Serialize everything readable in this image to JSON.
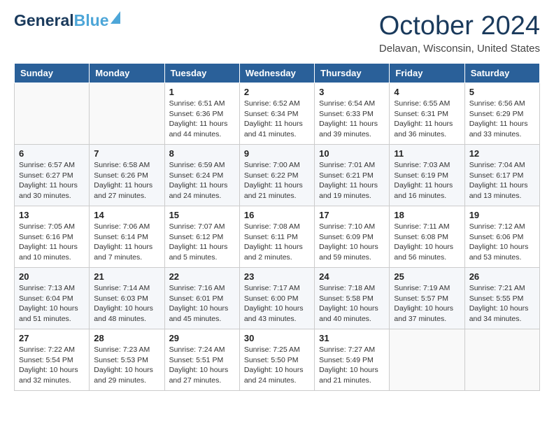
{
  "header": {
    "logo_general": "General",
    "logo_blue": "Blue",
    "month_title": "October 2024",
    "location": "Delavan, Wisconsin, United States"
  },
  "weekdays": [
    "Sunday",
    "Monday",
    "Tuesday",
    "Wednesday",
    "Thursday",
    "Friday",
    "Saturday"
  ],
  "weeks": [
    [
      {
        "day": "",
        "info": ""
      },
      {
        "day": "",
        "info": ""
      },
      {
        "day": "1",
        "info": "Sunrise: 6:51 AM\nSunset: 6:36 PM\nDaylight: 11 hours and 44 minutes."
      },
      {
        "day": "2",
        "info": "Sunrise: 6:52 AM\nSunset: 6:34 PM\nDaylight: 11 hours and 41 minutes."
      },
      {
        "day": "3",
        "info": "Sunrise: 6:54 AM\nSunset: 6:33 PM\nDaylight: 11 hours and 39 minutes."
      },
      {
        "day": "4",
        "info": "Sunrise: 6:55 AM\nSunset: 6:31 PM\nDaylight: 11 hours and 36 minutes."
      },
      {
        "day": "5",
        "info": "Sunrise: 6:56 AM\nSunset: 6:29 PM\nDaylight: 11 hours and 33 minutes."
      }
    ],
    [
      {
        "day": "6",
        "info": "Sunrise: 6:57 AM\nSunset: 6:27 PM\nDaylight: 11 hours and 30 minutes."
      },
      {
        "day": "7",
        "info": "Sunrise: 6:58 AM\nSunset: 6:26 PM\nDaylight: 11 hours and 27 minutes."
      },
      {
        "day": "8",
        "info": "Sunrise: 6:59 AM\nSunset: 6:24 PM\nDaylight: 11 hours and 24 minutes."
      },
      {
        "day": "9",
        "info": "Sunrise: 7:00 AM\nSunset: 6:22 PM\nDaylight: 11 hours and 21 minutes."
      },
      {
        "day": "10",
        "info": "Sunrise: 7:01 AM\nSunset: 6:21 PM\nDaylight: 11 hours and 19 minutes."
      },
      {
        "day": "11",
        "info": "Sunrise: 7:03 AM\nSunset: 6:19 PM\nDaylight: 11 hours and 16 minutes."
      },
      {
        "day": "12",
        "info": "Sunrise: 7:04 AM\nSunset: 6:17 PM\nDaylight: 11 hours and 13 minutes."
      }
    ],
    [
      {
        "day": "13",
        "info": "Sunrise: 7:05 AM\nSunset: 6:16 PM\nDaylight: 11 hours and 10 minutes."
      },
      {
        "day": "14",
        "info": "Sunrise: 7:06 AM\nSunset: 6:14 PM\nDaylight: 11 hours and 7 minutes."
      },
      {
        "day": "15",
        "info": "Sunrise: 7:07 AM\nSunset: 6:12 PM\nDaylight: 11 hours and 5 minutes."
      },
      {
        "day": "16",
        "info": "Sunrise: 7:08 AM\nSunset: 6:11 PM\nDaylight: 11 hours and 2 minutes."
      },
      {
        "day": "17",
        "info": "Sunrise: 7:10 AM\nSunset: 6:09 PM\nDaylight: 10 hours and 59 minutes."
      },
      {
        "day": "18",
        "info": "Sunrise: 7:11 AM\nSunset: 6:08 PM\nDaylight: 10 hours and 56 minutes."
      },
      {
        "day": "19",
        "info": "Sunrise: 7:12 AM\nSunset: 6:06 PM\nDaylight: 10 hours and 53 minutes."
      }
    ],
    [
      {
        "day": "20",
        "info": "Sunrise: 7:13 AM\nSunset: 6:04 PM\nDaylight: 10 hours and 51 minutes."
      },
      {
        "day": "21",
        "info": "Sunrise: 7:14 AM\nSunset: 6:03 PM\nDaylight: 10 hours and 48 minutes."
      },
      {
        "day": "22",
        "info": "Sunrise: 7:16 AM\nSunset: 6:01 PM\nDaylight: 10 hours and 45 minutes."
      },
      {
        "day": "23",
        "info": "Sunrise: 7:17 AM\nSunset: 6:00 PM\nDaylight: 10 hours and 43 minutes."
      },
      {
        "day": "24",
        "info": "Sunrise: 7:18 AM\nSunset: 5:58 PM\nDaylight: 10 hours and 40 minutes."
      },
      {
        "day": "25",
        "info": "Sunrise: 7:19 AM\nSunset: 5:57 PM\nDaylight: 10 hours and 37 minutes."
      },
      {
        "day": "26",
        "info": "Sunrise: 7:21 AM\nSunset: 5:55 PM\nDaylight: 10 hours and 34 minutes."
      }
    ],
    [
      {
        "day": "27",
        "info": "Sunrise: 7:22 AM\nSunset: 5:54 PM\nDaylight: 10 hours and 32 minutes."
      },
      {
        "day": "28",
        "info": "Sunrise: 7:23 AM\nSunset: 5:53 PM\nDaylight: 10 hours and 29 minutes."
      },
      {
        "day": "29",
        "info": "Sunrise: 7:24 AM\nSunset: 5:51 PM\nDaylight: 10 hours and 27 minutes."
      },
      {
        "day": "30",
        "info": "Sunrise: 7:25 AM\nSunset: 5:50 PM\nDaylight: 10 hours and 24 minutes."
      },
      {
        "day": "31",
        "info": "Sunrise: 7:27 AM\nSunset: 5:49 PM\nDaylight: 10 hours and 21 minutes."
      },
      {
        "day": "",
        "info": ""
      },
      {
        "day": "",
        "info": ""
      }
    ]
  ]
}
